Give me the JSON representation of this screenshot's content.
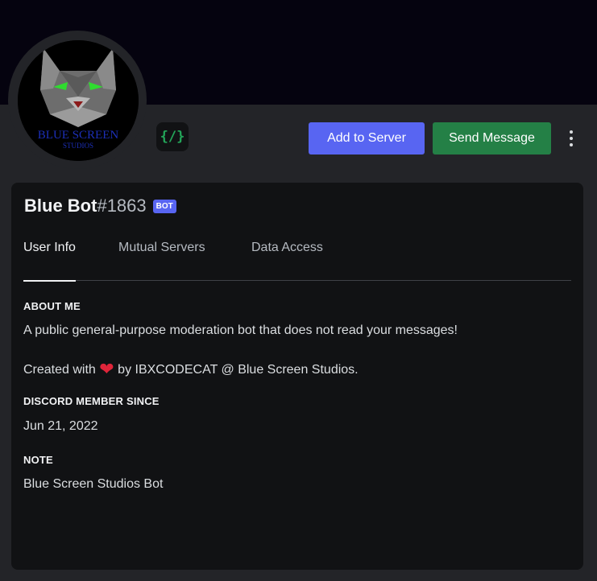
{
  "profile": {
    "avatar_text_line1": "BLUE SCREEN",
    "avatar_text_line2": "STUDIOS",
    "dev_badge_icon": "{/}",
    "username": "Blue Bot",
    "discriminator": "#1863",
    "bot_tag": "BOT"
  },
  "actions": {
    "add_to_server": "Add to Server",
    "send_message": "Send Message"
  },
  "tabs": [
    {
      "label": "User Info",
      "active": true
    },
    {
      "label": "Mutual Servers",
      "active": false
    },
    {
      "label": "Data Access",
      "active": false
    }
  ],
  "about": {
    "title": "ABOUT ME",
    "line1": "A public general-purpose moderation bot that does not read your messages!",
    "line2_pre": "Created with",
    "heart": "❤",
    "line2_post": "by IBXCODECAT @ Blue Screen Studios."
  },
  "member_since": {
    "title": "DISCORD MEMBER SINCE",
    "date": "Jun 21, 2022"
  },
  "note": {
    "title": "NOTE",
    "text": "Blue Screen Studios Bot"
  },
  "colors": {
    "blurple": "#5865f2",
    "green": "#248046",
    "banner": "#05030f"
  }
}
